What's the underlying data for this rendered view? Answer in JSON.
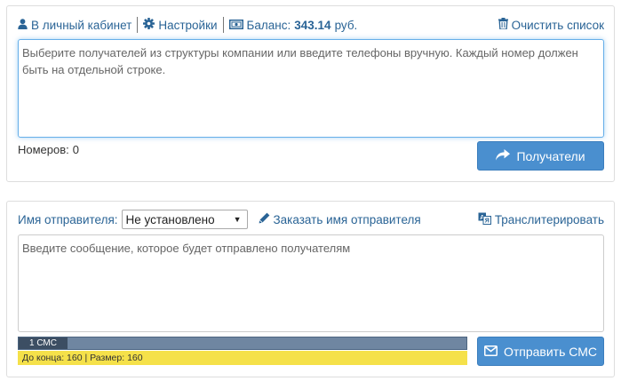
{
  "header": {
    "cabinet_label": "В личный кабинет",
    "settings_label": "Настройки",
    "balance_label": "Баланс:",
    "balance_value": "343.14",
    "balance_currency": "руб.",
    "clear_label": "Очистить список"
  },
  "recipients": {
    "placeholder": "Выберите получателей из структуры компании или введите телефоны вручную. Каждый номер должен быть на отдельной строке.",
    "value": "",
    "count_label": "Номеров:",
    "count_value": "0",
    "button_label": "Получатели"
  },
  "sender": {
    "label": "Имя отправителя:",
    "selected": "Не установлено",
    "order_label": "Заказать имя отправителя",
    "transliterate_label": "Транслитерировать"
  },
  "message": {
    "placeholder": "Введите сообщение, которое будет отправлено получателям",
    "value": "",
    "sms_count_label": "1 СМС",
    "remaining_label": "До конца:",
    "remaining_value": "160",
    "size_label": "Размер:",
    "size_value": "160",
    "send_label": "Отправить СМС"
  },
  "colors": {
    "link": "#2a6496",
    "button": "#4a8fcf",
    "sms_bar": "#6f86a1",
    "sms_segment": "#3c4e63",
    "info_bar": "#f5e14a"
  },
  "icons": {
    "cabinet": "user-icon",
    "settings": "gear-icon",
    "balance": "money-icon",
    "clear": "trash-icon",
    "recipients": "share-arrow-icon",
    "order": "pencil-icon",
    "transliterate": "translate-icon",
    "send": "envelope-icon"
  }
}
